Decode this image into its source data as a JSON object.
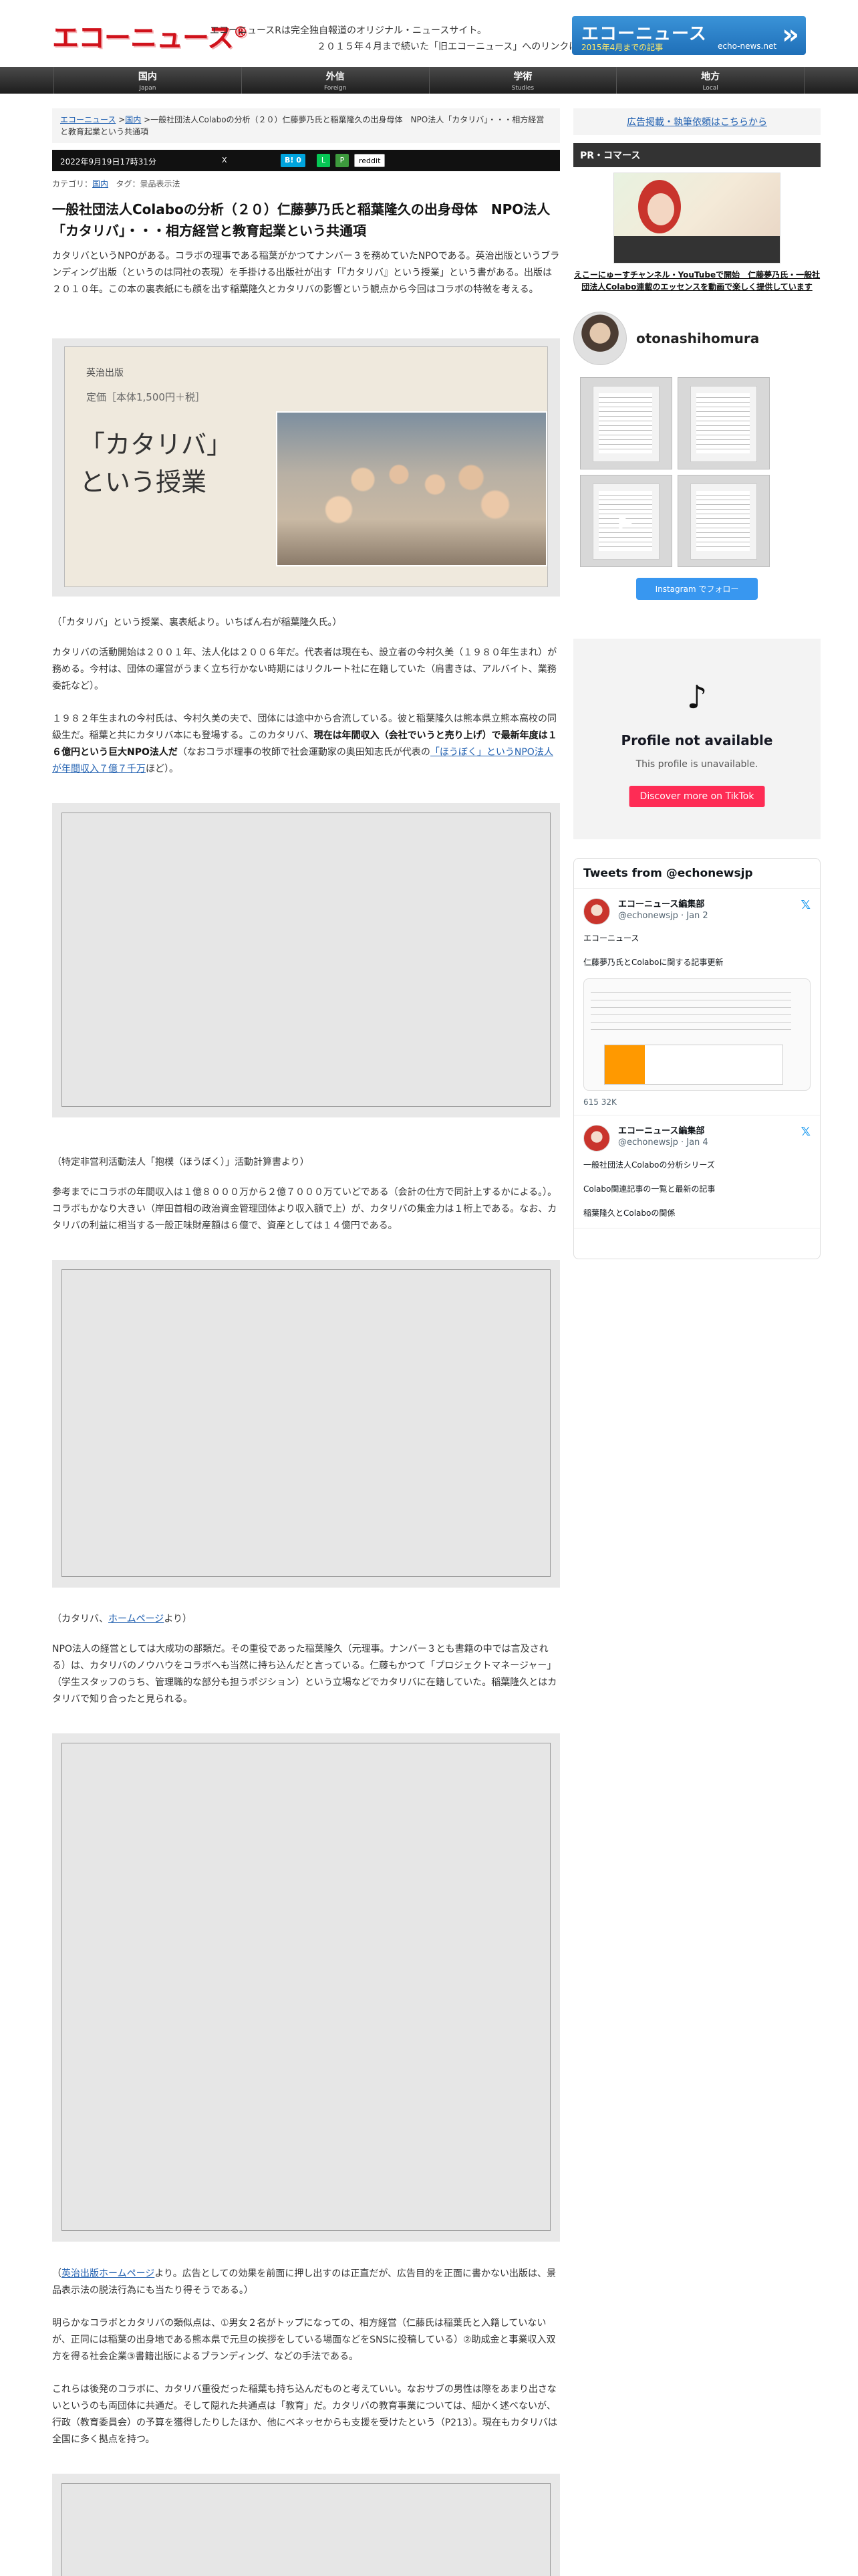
{
  "header": {
    "logo": "エコーニュース",
    "logo_mark": "®",
    "tagline_1": "エコーニュースRは完全独自報道のオリジナル・ニュースサイト。",
    "tagline_2": "２０１５年４月まで続いた「旧エコーニュース」へのリンクはこちら",
    "banner_title": "エコーニュース",
    "banner_sub": "2015年4月までの記事",
    "banner_url": "echo-news.net"
  },
  "nav": [
    {
      "jp": "国内",
      "en": "Japan"
    },
    {
      "jp": "外信",
      "en": "Foreign"
    },
    {
      "jp": "学術",
      "en": "Studies"
    },
    {
      "jp": "地方",
      "en": "Local"
    }
  ],
  "article": {
    "breadcrumb_home": "エコーニュース",
    "breadcrumb_cat": "国内",
    "breadcrumb_title": "一般社団法人Colaboの分析（２０）仁藤夢乃氏と稲葉隆久の出身母体　NPO法人「カタリバ」・・・相方経営と教育起業という共通項",
    "date": "2022年9月19日17時31分",
    "share_x": "X",
    "share_b": "B!",
    "share_b_count": "0",
    "share_reddit": "reddit",
    "category_label": "カテゴリ：",
    "category": "国内",
    "tags_label": "タグ：",
    "tags": "景品表示法",
    "title": "一般社団法人Colaboの分析（２０）仁藤夢乃氏と稲葉隆久の出身母体　NPO法人「カタリバ」・・・相方経営と教育起業という共通項",
    "p1": "カタリバというNPOがある。コラボの理事である稲葉がかつてナンバー３を務めていたNPOである。英治出版というブランディング出版（というのは同社の表現）を手掛ける出版社が出す「『カタリバ』という授業」という書がある。出版は２０１０年。この本の裏表紙にも顔を出す稲葉隆久とカタリバの影響という観点から今回はコラボの特徴を考える。",
    "book_publisher": "英治出版",
    "book_price": "定価［本体1,500円＋税］",
    "book_title_1": "「カタリバ」",
    "book_title_2": "という授業",
    "caption1": "（「カタリバ」という授業、裏表紙より。いちばん右が稲葉隆久氏。）",
    "p2": "カタリバの活動開始は２００１年、法人化は２００６年だ。代表者は現在も、設立者の今村久美（１９８０年生まれ）が務める。今村は、団体の運営がうまく立ち行かない時期にはリクルート社に在籍していた（肩書きは、アルバイト、業務委託など）。",
    "p3_a": "１９８２年生まれの今村氏は、今村久美の夫で、団体には途中から合流している。彼と稲葉隆久は熊本県立熊本高校の同級生だ。稲葉と共にカタリバ本にも登場する。このカタリバ、",
    "p3_b": "現在は年間収入（会社でいうと売り上げ）で最新年度は１６億円という巨大NPO法人だ",
    "p3_c": "（なおコラボ理事の牧師で社会運動家の奥田知志氏が代表の",
    "p3_link": "「ほうぼく」というNPO法人が年間収入７億７千万",
    "p3_d": "ほど）。",
    "caption2": "（特定非営利活動法人「抱樸（ほうぼく）」活動計算書より）",
    "p4": "参考までにコラボの年間収入は１億８０００万から２億７０００万ていどである（会計の仕方で同計上するかによる。）。コラボもかなり大きい（岸田首相の政治資金管理団体より収入額で上）が、カタリバの集金力は１桁上である。なお、カタリバの利益に相当する一般正味財産額は６億で、資産としては１４億円である。",
    "caption3_a": "（カタリバ、",
    "caption3_link": "ホームページ",
    "caption3_b": "より）",
    "p5": "NPO法人の経営としては大成功の部類だ。その重役であった稲葉隆久（元理事。ナンバー３とも書籍の中では言及される）は、カタリバのノウハウをコラボへも当然に持ち込んだと言っている。仁藤もかつて「プロジェクトマネージャー」（学生スタッフのうち、管理職的な部分も担うポジション）という立場などでカタリバに在籍していた。稲葉隆久とはカタリバで知り合ったと見られる。",
    "caption4_a": "（",
    "caption4_link": "英治出版ホームページ",
    "caption4_b": "より。広告としての効果を前面に押し出すのは正直だが、広告目的を正面に書かない出版は、景品表示法の脱法行為にも当たり得そうである。）",
    "p6": "明らかなコラボとカタリバの類似点は、①男女２名がトップになっての、相方経営（仁藤氏は稲葉氏と入籍していないが、正同には稲葉の出身地である熊本県で元旦の挨拶をしている場面などをSNSに投稿している）②助成金と事業収入双方を得る社会企業③書籍出版によるブランディング、などの手法である。",
    "p7": "これらは後発のコラボに、カタリバ重役だった稲葉も持ち込んだものと考えていい。なおサブの男性は際をあまり出さないというのも両団体に共通だ。そして隠れた共通点は「教育」だ。カタリバの教育事業については、細かく述べないが、行政（教育委員会）の予算を獲得したりしたほか、他にベネッセからも支援を受けたという（P213）。現在もカタリバは全国に多く拠点を持つ。"
  },
  "sidebar": {
    "ad_link": "広告掲載・執筆依頼はこちらから",
    "pr_heading": "PR・コマース",
    "pr_text": "えこーにゅーすチャンネル・YouTubeで開始　仁藤夢乃氏・一般社団法人Colabo連載のエッセンスを動画で楽しく提供しています",
    "ig_name": "otonashihomura",
    "ig_button": "Instagram でフォロー",
    "tiktok_title": "Profile not available",
    "tiktok_sub": "This profile is unavailable.",
    "tiktok_button": "Discover more on TikTok",
    "twitter_head": "Tweets from @echonewsjp",
    "tweets": [
      {
        "name": "エコーニュース編集部",
        "handle": "@echonewsjp · Jan 2",
        "text_1": "エコーニュース",
        "text_2": "仁藤夢乃氏とColaboに関する記事更新",
        "stats": "615  32K"
      },
      {
        "name": "エコーニュース編集部",
        "handle": "@echonewsjp · Jan 4",
        "text_1": "一般社団法人Colaboの分析シリーズ",
        "text_2": "Colabo関連記事の一覧と最新の記事",
        "text_3": "稲葉隆久とColaboの関係"
      }
    ]
  }
}
